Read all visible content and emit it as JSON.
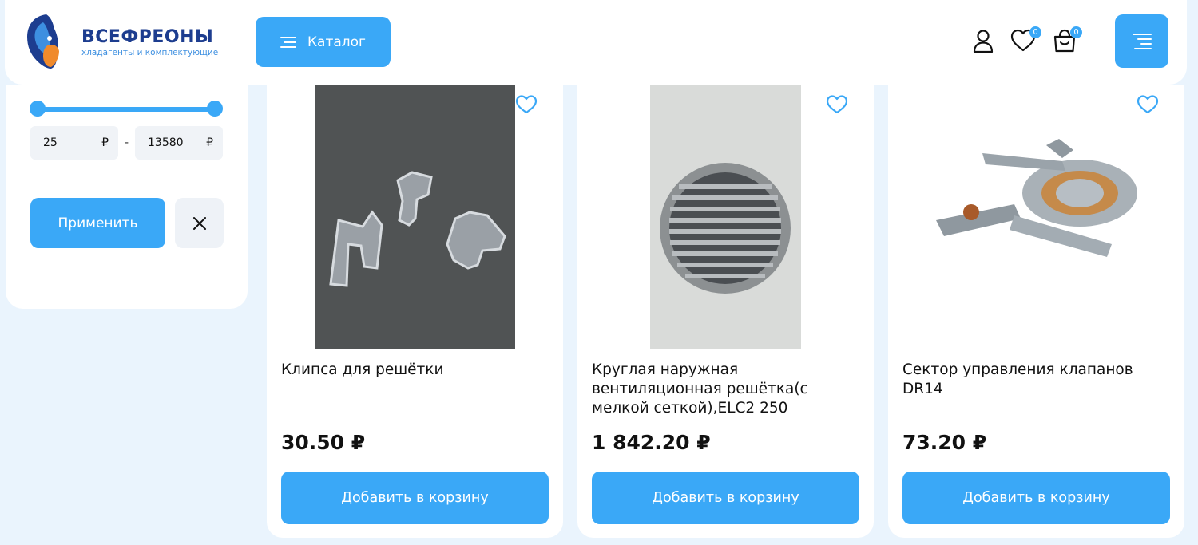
{
  "header": {
    "logo_title": "ВСЕФРЕОНЫ",
    "logo_subtitle": "хладагенты и комплектующие",
    "catalog_label": "Каталог",
    "favorites_count": "0",
    "cart_count": "0"
  },
  "filter": {
    "price_min": "25",
    "price_max": "13580",
    "currency": "₽",
    "separator": "-",
    "apply_label": "Применить"
  },
  "products": [
    {
      "name": "Клипса для решётки",
      "price": "30.50 ₽",
      "cart_label": "Добавить в корзину"
    },
    {
      "name": "Круглая наружная вентиляционная решётка(с мелкой сеткой),ELC2 250",
      "price": "1 842.20 ₽",
      "cart_label": "Добавить в корзину"
    },
    {
      "name": "Сектор управления клапанов DR14",
      "price": "73.20 ₽",
      "cart_label": "Добавить в корзину"
    }
  ],
  "colors": {
    "accent": "#3aa8f7",
    "background": "#eaf4fd",
    "logo_dark": "#1d3d8f"
  },
  "icons": [
    "menu-lines-icon",
    "user-icon",
    "heart-icon",
    "bag-icon",
    "burger-icon",
    "close-icon"
  ]
}
